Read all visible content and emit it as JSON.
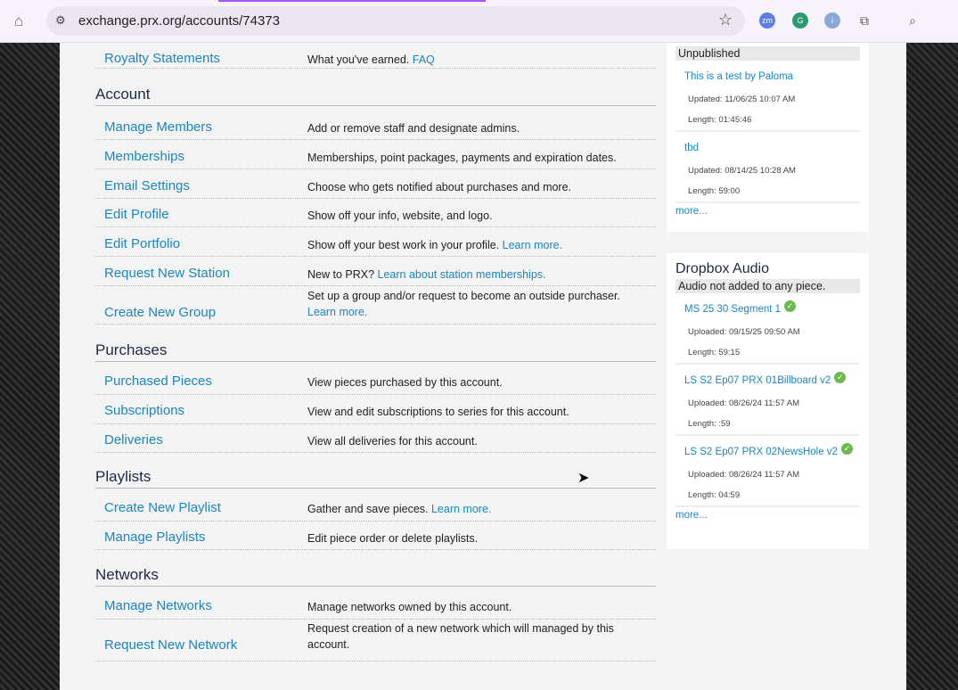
{
  "browser": {
    "url": "exchange.prx.org/accounts/74373"
  },
  "main": {
    "top_row": {
      "label": "Royalty Statements",
      "desc": "What you've earned.",
      "link": "FAQ"
    },
    "sections": [
      {
        "title": "Account",
        "rows": [
          {
            "label": "Manage Members",
            "desc": "Add or remove staff and designate admins."
          },
          {
            "label": "Memberships",
            "desc": "Memberships, point packages, payments and expiration dates."
          },
          {
            "label": "Email Settings",
            "desc": "Choose who gets notified about purchases and more."
          },
          {
            "label": "Edit Profile",
            "desc": "Show off your info, website, and logo."
          },
          {
            "label": "Edit Portfolio",
            "desc": "Show off your best work in your profile.",
            "link": "Learn more."
          },
          {
            "label": "Request New Station",
            "desc": "New to PRX?",
            "link": "Learn about station memberships."
          },
          {
            "label": "Create New Group",
            "desc": "Set up a group and/or request to become an outside purchaser.",
            "link": "Learn more."
          }
        ]
      },
      {
        "title": "Purchases",
        "rows": [
          {
            "label": "Purchased Pieces",
            "desc": "View pieces purchased by this account."
          },
          {
            "label": "Subscriptions",
            "desc": "View and edit subscriptions to series for this account."
          },
          {
            "label": "Deliveries",
            "desc": "View all deliveries for this account."
          }
        ]
      },
      {
        "title": "Playlists",
        "rows": [
          {
            "label": "Create New Playlist",
            "desc": "Gather and save pieces.",
            "link": "Learn more."
          },
          {
            "label": "Manage Playlists",
            "desc": "Edit piece order or delete playlists."
          }
        ]
      },
      {
        "title": "Networks",
        "rows": [
          {
            "label": "Manage Networks",
            "desc": "Manage networks owned by this account."
          },
          {
            "label": "Request New Network",
            "desc": "Request creation of a new network which will managed by this account."
          }
        ]
      }
    ]
  },
  "sidebar": {
    "unpublished": {
      "bar": "Unpublished",
      "items": [
        {
          "title": "This is a test by Paloma",
          "meta1": "Updated: 11/06/25 10:07 AM",
          "meta2": "Length: 01:45:46"
        },
        {
          "title": "tbd",
          "meta1": "Updated: 08/14/25 10:28 AM",
          "meta2": "Length: 59:00"
        }
      ],
      "more": "more..."
    },
    "dropbox": {
      "title": "Dropbox Audio",
      "bar": "Audio not added to any piece.",
      "items": [
        {
          "title": "MS 25 30 Segment 1",
          "meta1": "Uploaded: 09/15/25 09:50 AM",
          "meta2": "Length: 59:15"
        },
        {
          "title": "LS S2 Ep07 PRX 01Billboard v2",
          "meta1": "Uploaded: 08/26/24 11:57 AM",
          "meta2": "Length: :59"
        },
        {
          "title": "LS S2 Ep07 PRX 02NewsHole v2",
          "meta1": "Uploaded: 08/26/24 11:57 AM",
          "meta2": "Length: 04:59"
        }
      ],
      "more": "more..."
    }
  }
}
